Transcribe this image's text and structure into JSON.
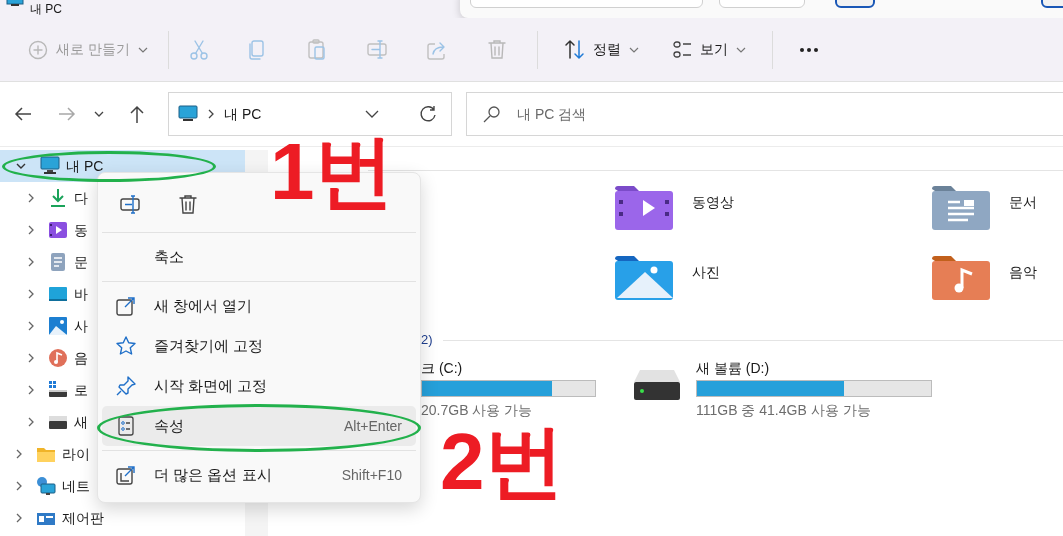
{
  "window": {
    "title": "내 PC"
  },
  "toolbar": [
    {
      "kind": "new",
      "label": "새로 만들기",
      "disabled": true
    },
    {
      "kind": "cut",
      "disabled": true
    },
    {
      "kind": "copy",
      "disabled": true
    },
    {
      "kind": "paste",
      "disabled": true
    },
    {
      "kind": "rename",
      "disabled": true
    },
    {
      "kind": "share",
      "disabled": true
    },
    {
      "kind": "delete",
      "disabled": true
    },
    {
      "kind": "sort",
      "label": "정렬",
      "disabled": false
    },
    {
      "kind": "view",
      "label": "보기",
      "disabled": false
    },
    {
      "kind": "more",
      "disabled": false
    }
  ],
  "navigation": [
    {
      "kind": "back",
      "disabled": false
    },
    {
      "kind": "forward",
      "disabled": true
    },
    {
      "kind": "recent",
      "disabled": false
    },
    {
      "kind": "up",
      "disabled": false
    }
  ],
  "address_bar": {
    "path": "내 PC"
  },
  "search": {
    "placeholder": "내 PC 검색"
  },
  "sidebar": {
    "items": [
      {
        "label": "내 PC",
        "kind": "pc",
        "selected": true,
        "expanded": true,
        "children": [
          {
            "label": "다",
            "kind": "download",
            "selected": false,
            "expanded": false
          },
          {
            "label": "동",
            "kind": "videos",
            "selected": false,
            "expanded": false
          },
          {
            "label": "문",
            "kind": "documents",
            "selected": false,
            "expanded": false
          },
          {
            "label": "바",
            "kind": "desktop",
            "selected": false,
            "expanded": false
          },
          {
            "label": "사",
            "kind": "pictures",
            "selected": false,
            "expanded": false
          },
          {
            "label": "음",
            "kind": "music",
            "selected": false,
            "expanded": false
          },
          {
            "label": "로",
            "kind": "windrive",
            "selected": false,
            "expanded": false
          },
          {
            "label": "새",
            "kind": "drive",
            "selected": false,
            "expanded": false
          }
        ]
      },
      {
        "label": "라이",
        "kind": "folder",
        "selected": false,
        "expanded": false
      },
      {
        "label": "네트",
        "kind": "network",
        "selected": false,
        "expanded": false
      },
      {
        "label": "제어판",
        "kind": "control",
        "selected": false,
        "expanded": false
      }
    ]
  },
  "content": {
    "sections": [
      {
        "kind": "folders",
        "items": [
          {
            "label": "동영상",
            "kind": "videos"
          },
          {
            "label": "문서",
            "kind": "documents"
          },
          {
            "label": "사진",
            "kind": "pictures"
          },
          {
            "label": "음악",
            "kind": "music"
          }
        ]
      },
      {
        "kind": "drives",
        "title": "2)",
        "items": [
          {
            "label": "크 (C:)",
            "level": 0.75,
            "free": "20.7GB 사용 가능",
            "kind": "partial"
          },
          {
            "label": "새 볼륨 (D:)",
            "level": 0.63,
            "free": "111GB 중 41.4GB 사용 가능",
            "kind": "drive"
          }
        ]
      }
    ]
  },
  "context_menu": {
    "top_actions": [
      {
        "kind": "rename"
      },
      {
        "kind": "delete"
      }
    ],
    "groups": [
      [
        {
          "label": "축소",
          "kind": "plain",
          "selected": false
        }
      ],
      [
        {
          "label": "새 창에서 열기",
          "kind": "open",
          "selected": false
        },
        {
          "label": "즐겨찾기에 고정",
          "kind": "star",
          "selected": false
        },
        {
          "label": "시작 화면에 고정",
          "kind": "pin",
          "selected": false
        },
        {
          "label": "속성",
          "kind": "properties",
          "shortcut": "Alt+Enter",
          "selected": true
        }
      ],
      [
        {
          "label": "더 많은 옵션 표시",
          "kind": "more-options",
          "shortcut": "Shift+F10",
          "selected": false
        }
      ]
    ]
  },
  "annotations": [
    {
      "text": "1번"
    },
    {
      "text": "2번"
    }
  ]
}
